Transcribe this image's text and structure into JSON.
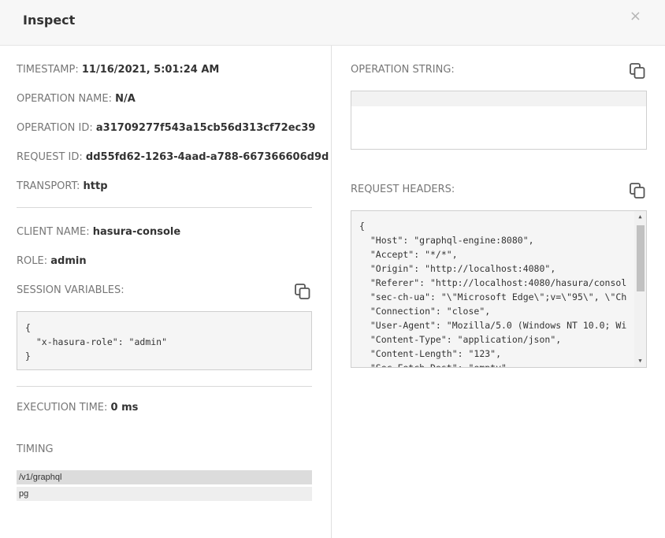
{
  "header": {
    "title": "Inspect",
    "close": "×"
  },
  "left": {
    "timestamp": {
      "label": "TIMESTAMP:",
      "value": "11/16/2021, 5:01:24 AM"
    },
    "operation_name": {
      "label": "OPERATION NAME:",
      "value": "N/A"
    },
    "operation_id": {
      "label": "OPERATION ID:",
      "value": "a31709277f543a15cb56d313cf72ec39"
    },
    "request_id": {
      "label": "REQUEST ID:",
      "value": "dd55fd62-1263-4aad-a788-667366606d9d"
    },
    "transport": {
      "label": "TRANSPORT:",
      "value": "http"
    },
    "client_name": {
      "label": "CLIENT NAME:",
      "value": "hasura-console"
    },
    "role": {
      "label": "ROLE:",
      "value": "admin"
    },
    "session_variables": {
      "label": "SESSION VARIABLES:",
      "code": "{\n  \"x-hasura-role\": \"admin\"\n}"
    },
    "execution_time": {
      "label": "EXECUTION TIME:",
      "value": "0 ms"
    },
    "timing": {
      "label": "TIMING",
      "bars": [
        "/v1/graphql",
        "pg"
      ]
    }
  },
  "right": {
    "operation_string": {
      "label": "OPERATION STRING:",
      "code": ""
    },
    "request_headers": {
      "label": "REQUEST HEADERS:",
      "code": "{\n  \"Host\": \"graphql-engine:8080\",\n  \"Accept\": \"*/*\",\n  \"Origin\": \"http://localhost:4080\",\n  \"Referer\": \"http://localhost:4080/hasura/consol\n  \"sec-ch-ua\": \"\\\"Microsoft Edge\\\";v=\\\"95\\\", \\\"Ch\n  \"Connection\": \"close\",\n  \"User-Agent\": \"Mozilla/5.0 (Windows NT 10.0; Wi\n  \"Content-Type\": \"application/json\",\n  \"Content-Length\": \"123\",\n  \"Sec-Fetch-Dest\": \"empty\","
    }
  },
  "colors": {
    "timing_bar_1": "#dcdcdc",
    "timing_bar_2": "#eeeeee",
    "copy_icon": "#555555"
  },
  "icons": {
    "copy": "copy-icon",
    "close": "close-icon"
  }
}
